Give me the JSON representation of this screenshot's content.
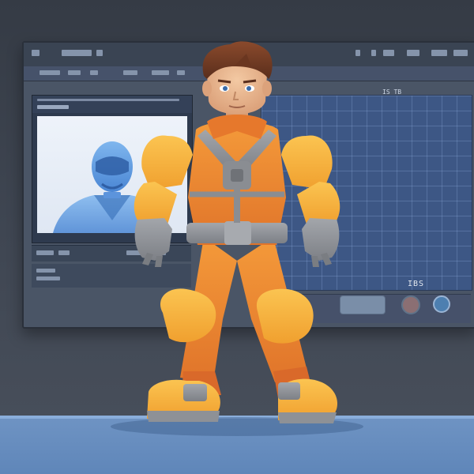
{
  "scene": {
    "description_colors": {
      "wall": "#3f4550",
      "floor": "#6e93c3",
      "monitor_grid": "#3d5785",
      "suit_orange": "#f08a2e",
      "suit_yellow": "#f7b43a",
      "armor_gray": "#8c8f94"
    }
  },
  "monitor": {
    "grid_label": "IS TB",
    "status_label": "IBS"
  }
}
